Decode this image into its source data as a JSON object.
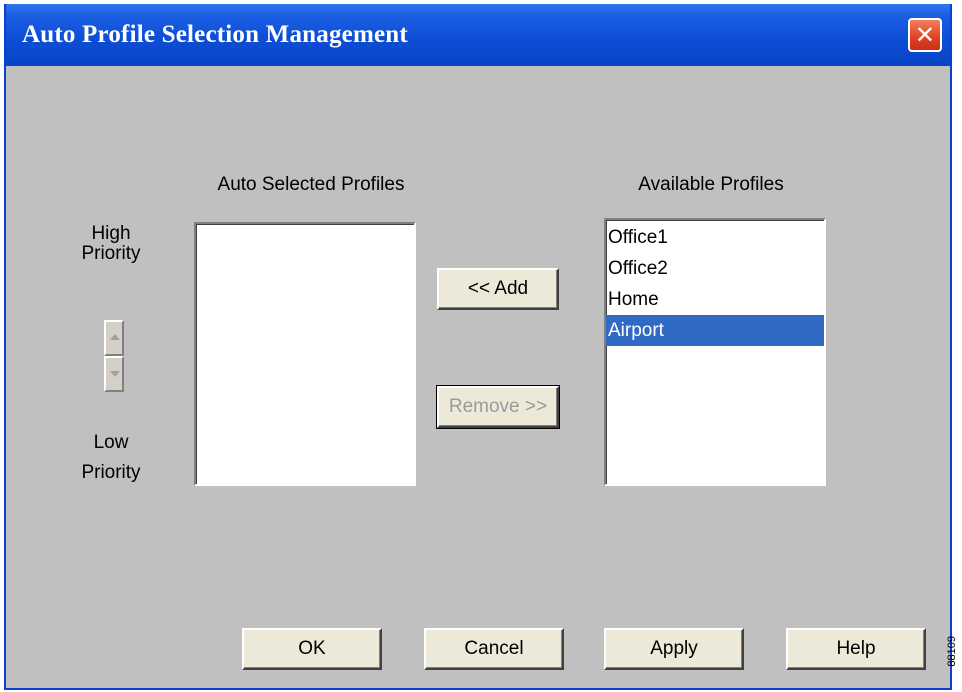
{
  "window": {
    "title": "Auto Profile Selection Management",
    "close_symbol": "✕"
  },
  "priority": {
    "high_line1": "High",
    "high_line2": "Priority",
    "low_line1": "Low",
    "low_line2": "Priority",
    "up_icon": "up-arrow-icon",
    "down_icon": "down-arrow-icon"
  },
  "auto_selected": {
    "heading": "Auto Selected Profiles",
    "items": []
  },
  "available": {
    "heading": "Available Profiles",
    "items": [
      {
        "label": "Office1",
        "selected": false
      },
      {
        "label": "Office2",
        "selected": false
      },
      {
        "label": "Home",
        "selected": false
      },
      {
        "label": "Airport",
        "selected": true
      }
    ]
  },
  "actions": {
    "add_label": "<< Add",
    "remove_label": "Remove >>"
  },
  "footer": {
    "ok_label": "OK",
    "cancel_label": "Cancel",
    "apply_label": "Apply",
    "help_label": "Help"
  },
  "figure_number": "88109",
  "colors": {
    "titlebar": "#0c4ed6",
    "selection": "#316ac5",
    "dialog_bg": "#c0c0c0"
  }
}
